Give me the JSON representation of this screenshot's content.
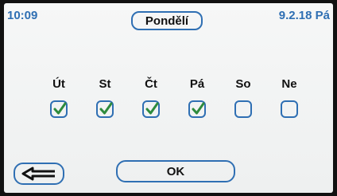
{
  "status_bar": {
    "time": "10:09",
    "date": "9.2.18 Pá"
  },
  "title": "Pondělí",
  "days": [
    {
      "label": "Út",
      "checked": true
    },
    {
      "label": "St",
      "checked": true
    },
    {
      "label": "Čt",
      "checked": true
    },
    {
      "label": "Pá",
      "checked": true
    },
    {
      "label": "So",
      "checked": false
    },
    {
      "label": "Ne",
      "checked": false
    }
  ],
  "buttons": {
    "back_icon": "arrow-left-icon",
    "ok_label": "OK"
  },
  "colors": {
    "accent": "#2f6fb3",
    "check": "#2e8b3d",
    "background": "#f2f3f3"
  }
}
